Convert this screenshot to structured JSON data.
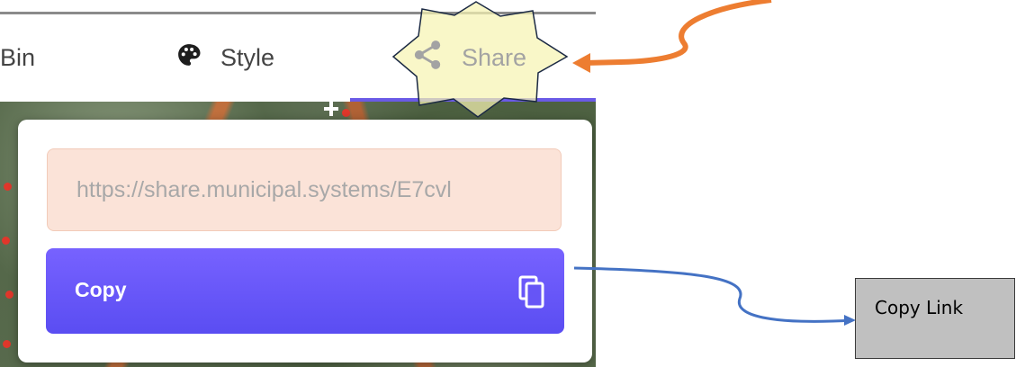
{
  "tabs": {
    "bin_label": "Bin",
    "style_label": "Style",
    "share_label": "Share",
    "active_tab": "Share",
    "style_icon": "palette-icon",
    "share_icon": "share-icon"
  },
  "share_panel": {
    "url_value": "https://share.municipal.systems/E7cvl",
    "copy_label": "Copy",
    "copy_icon": "copy-icon"
  },
  "annotation": {
    "callout_label": "Copy Link"
  },
  "colors": {
    "accent": "#6a5ae6",
    "copy_button": "#6655f6",
    "url_field_bg": "#fbe3d8",
    "highlight_star": "#f7f4b3",
    "arrow_orange": "#ed7d31",
    "arrow_blue": "#4472c4",
    "callout_bg": "#c0c0c0"
  }
}
